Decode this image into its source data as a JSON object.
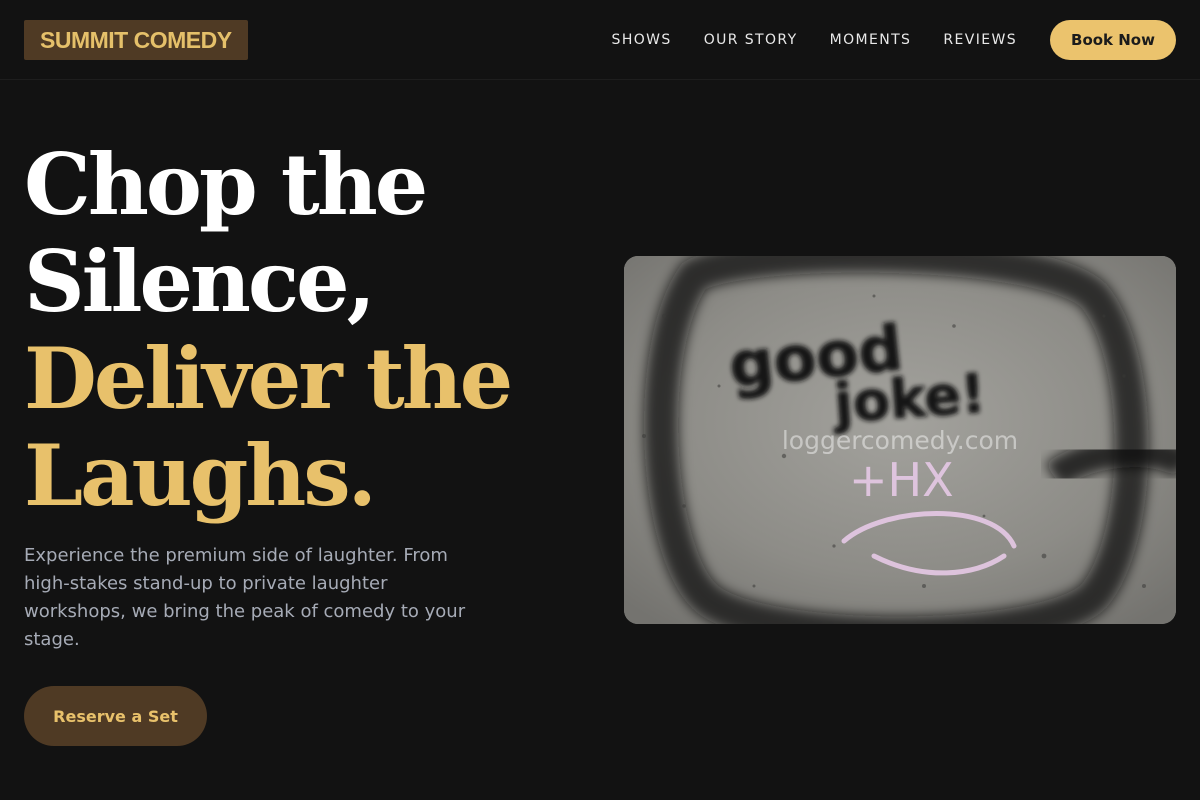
{
  "header": {
    "logo": "SUMMIT COMEDY",
    "nav": [
      "SHOWS",
      "OUR STORY",
      "MOMENTS",
      "REVIEWS"
    ],
    "cta": "Book Now"
  },
  "hero": {
    "title_line1": "Chop the",
    "title_line2": "Silence,",
    "title_line3": "Deliver the",
    "title_line4": "Laughs.",
    "subtitle": "Experience the premium side of laughter. From high-stakes stand-up to private laughter workshops, we bring the peak of comedy to your stage.",
    "cta": "Reserve a Set",
    "image_watermark": "loggercomedy.com",
    "image_graffiti": [
      "good",
      "joke!",
      "+HX"
    ]
  },
  "colors": {
    "background": "#121212",
    "accent": "#e8c16b",
    "brown": "#4f3a24",
    "subtext": "#a6abb6"
  }
}
